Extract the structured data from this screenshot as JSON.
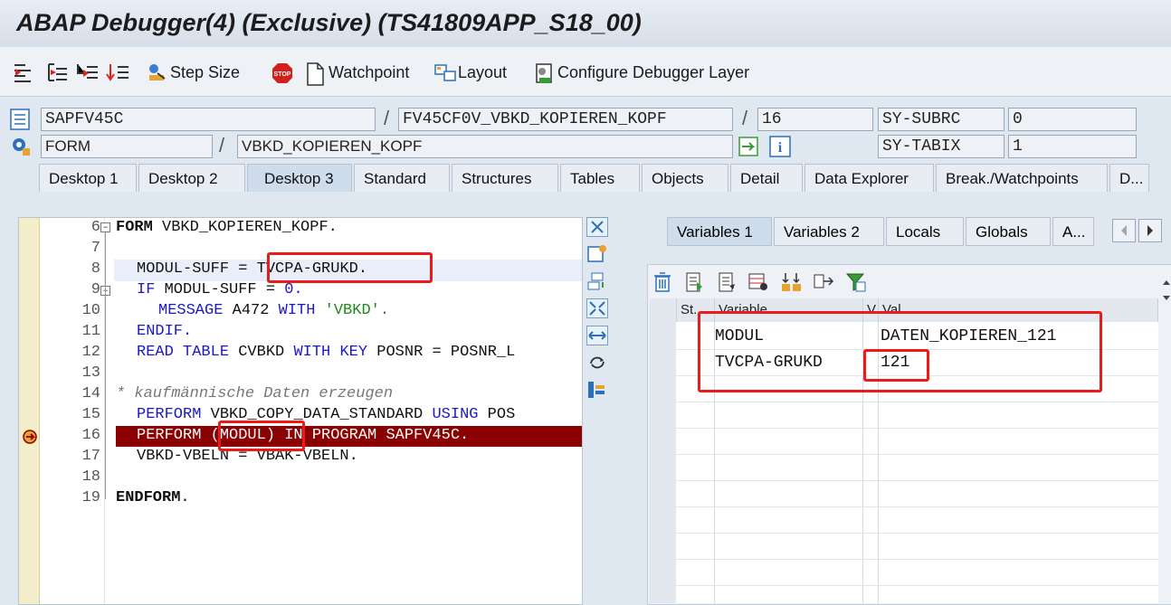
{
  "window": {
    "title": "ABAP Debugger(4)  (Exclusive) (TS41809APP_S18_00)"
  },
  "toolbar": {
    "step_size": "Step Size",
    "watchpoint": "Watchpoint",
    "layout": "Layout",
    "configure": "Configure Debugger Layer"
  },
  "info": {
    "program": "SAPFV45C",
    "include": "FV45CF0V_VBKD_KOPIEREN_KOPF",
    "line": "16",
    "type": "FORM",
    "name": "VBKD_KOPIEREN_KOPF",
    "sy_subrc_label": "SY-SUBRC",
    "sy_subrc_value": "0",
    "sy_tabix_label": "SY-TABIX",
    "sy_tabix_value": "1",
    "sep": "/"
  },
  "tabs": [
    "Desktop 1",
    "Desktop 2",
    "Desktop 3",
    "Standard",
    "Structures",
    "Tables",
    "Objects",
    "Detail",
    "Data Explorer",
    "Break./Watchpoints",
    "D..."
  ],
  "code": {
    "line_numbers": [
      "6",
      "7",
      "8",
      "9",
      "10",
      "11",
      "12",
      "13",
      "14",
      "15",
      "16",
      "17",
      "18",
      "19"
    ],
    "l6_kw": "FORM",
    "l6_rest": " VBKD_KOPIEREN_KOPF.",
    "l8_a": "MODUL-SUFF = ",
    "l8_b": "TVCPA-GRUKD.",
    "l9_kw": "IF",
    "l9_rest": " MODUL-SUFF = ",
    "l9_num": "0.",
    "l10_kw": "MESSAGE",
    "l10_a": " A472 ",
    "l10_kw2": "WITH",
    "l10_str": " 'VBKD'.",
    "l11_kw": "ENDIF.",
    "l12_kw": "READ TABLE",
    "l12_a": " CVBKD ",
    "l12_kw2": "WITH KEY",
    "l12_b": " POSNR = POSNR_L",
    "l14_cmt": "* kaufmännische Daten erzeugen",
    "l15_kw": "PERFORM",
    "l15_a": " VBKD_COPY_DATA_STANDARD ",
    "l15_kw2": "USING",
    "l15_b": " POS",
    "l16": "PERFORM (MODUL) IN PROGRAM SAPFV45C.",
    "l17": "VBKD-VBELN = VBAK-VBELN.",
    "l19_kw": "ENDFORM",
    "l19_rest": "."
  },
  "right_tabs": [
    "Variables 1",
    "Variables 2",
    "Locals",
    "Globals",
    "A..."
  ],
  "grid": {
    "headers": [
      "St...",
      "Variable",
      "V",
      "Val."
    ],
    "rows": [
      {
        "variable": "MODUL",
        "value": "DATEN_KOPIEREN_121"
      },
      {
        "variable": "TVCPA-GRUKD",
        "value": "121"
      }
    ]
  }
}
